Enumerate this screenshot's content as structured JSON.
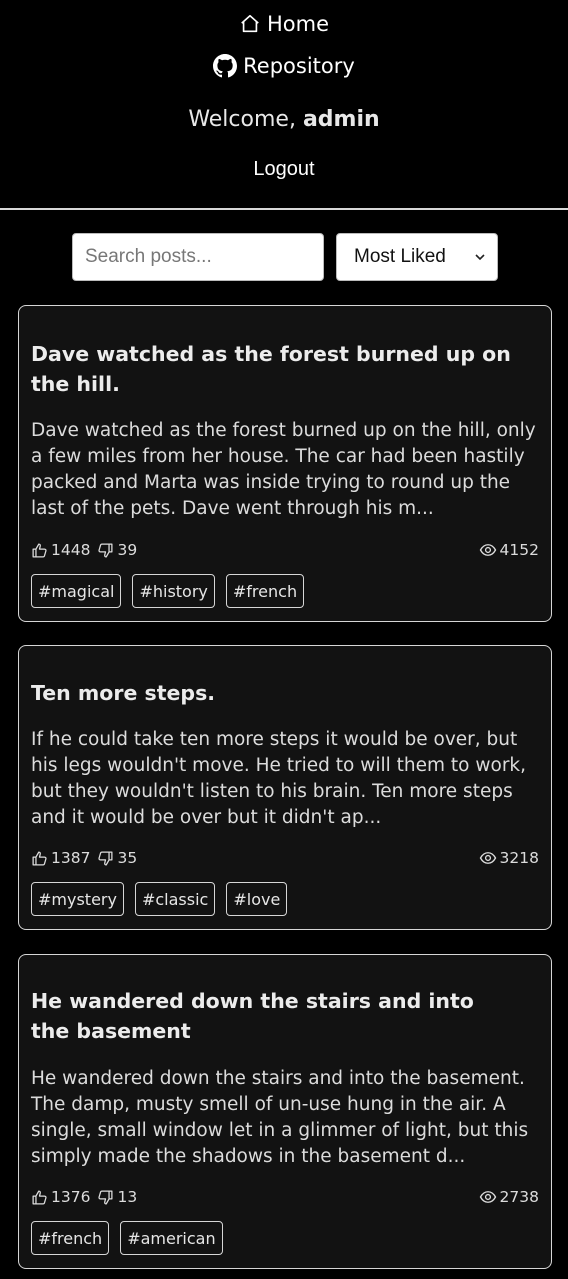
{
  "nav": {
    "home_label": "Home",
    "repo_label": "Repository",
    "welcome_prefix": "Welcome,",
    "username": "admin",
    "logout_label": "Logout"
  },
  "controls": {
    "search_placeholder": "Search posts...",
    "sort_value": "Most Liked"
  },
  "posts": [
    {
      "title": "Dave watched as the forest burned up on the hill.",
      "excerpt": "Dave watched as the forest burned up on the hill, only a few miles from her house. The car had been hastily packed and Marta was inside trying to round up the last of the pets. Dave went through his m...",
      "likes": "1448",
      "dislikes": "39",
      "views": "4152",
      "tags": [
        "#magical",
        "#history",
        "#french"
      ]
    },
    {
      "title": "Ten more steps.",
      "excerpt": "If he could take ten more steps it would be over, but his legs wouldn't move. He tried to will them to work, but they wouldn't listen to his brain. Ten more steps and it would be over but it didn't ap...",
      "likes": "1387",
      "dislikes": "35",
      "views": "3218",
      "tags": [
        "#mystery",
        "#classic",
        "#love"
      ]
    },
    {
      "title": "He wandered down the stairs and into the basement",
      "excerpt": "He wandered down the stairs and into the basement. The damp, musty smell of un-use hung in the air. A single, small window let in a glimmer of light, but this simply made the shadows in the basement d...",
      "likes": "1376",
      "dislikes": "13",
      "views": "2738",
      "tags": [
        "#french",
        "#american"
      ]
    }
  ]
}
